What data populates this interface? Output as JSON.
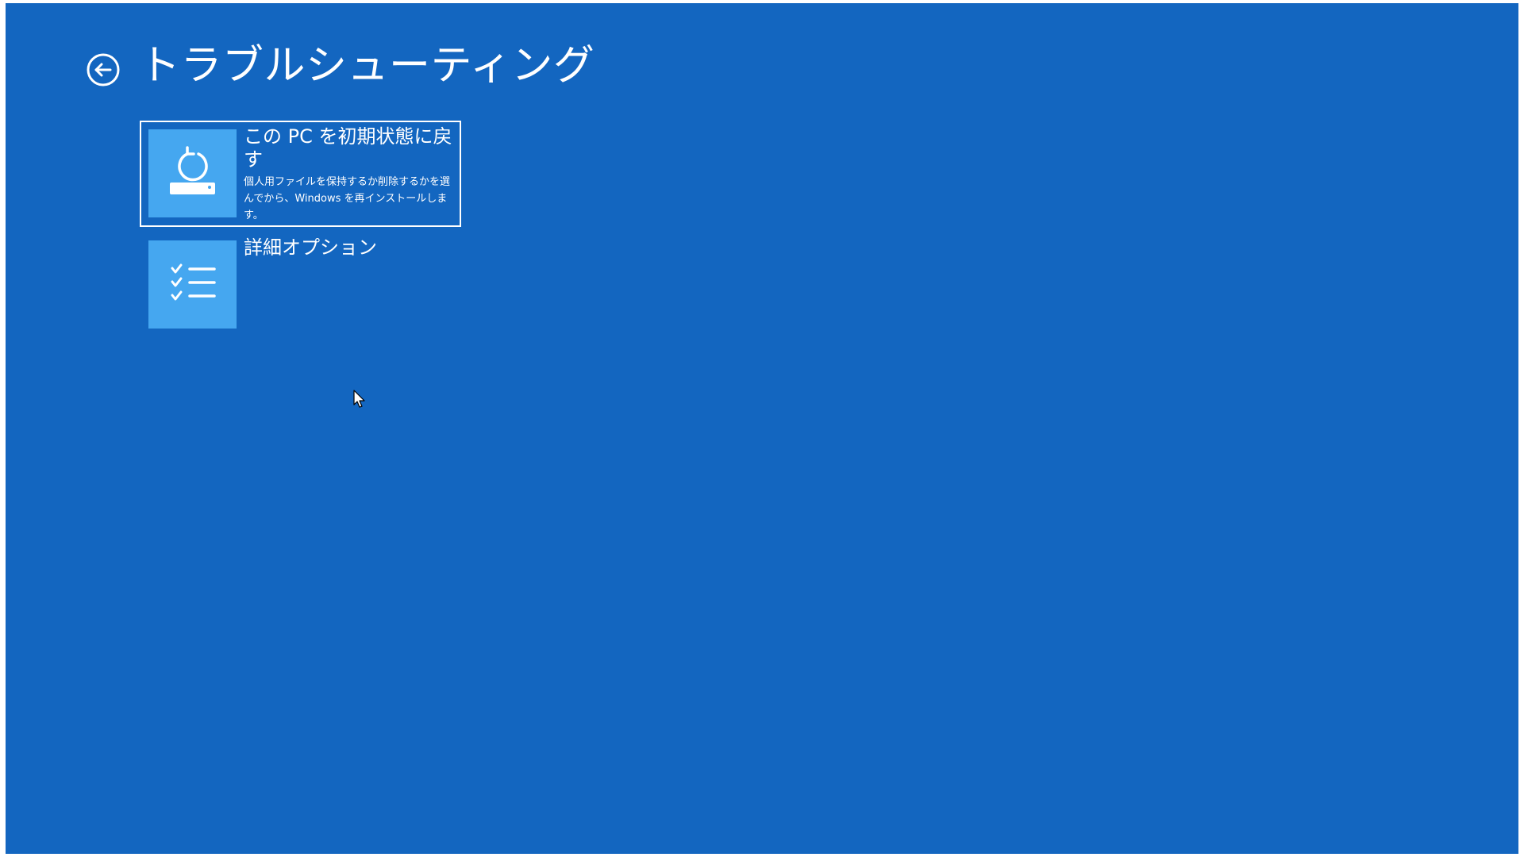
{
  "header": {
    "title": "トラブルシューティング",
    "back_icon": "back-arrow-circle-icon"
  },
  "options": [
    {
      "title": "この PC を初期状態に戻す",
      "description": "個人用ファイルを保持するか削除するかを選んでから、Windows を再インストールします。",
      "icon": "reset-pc-icon",
      "selected": true
    },
    {
      "title": "詳細オプション",
      "description": "",
      "icon": "checklist-icon",
      "selected": false
    }
  ],
  "colors": {
    "background": "#1366c0",
    "tile": "#45a7f0",
    "text": "#ffffff"
  }
}
